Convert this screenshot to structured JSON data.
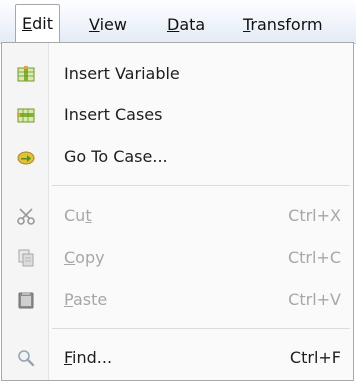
{
  "menubar": {
    "items": [
      {
        "label": "Edit",
        "mnemonic": "E",
        "rest": "dit",
        "active": true
      },
      {
        "label": "View",
        "mnemonic": "V",
        "rest": "iew"
      },
      {
        "label": "Data",
        "mnemonic": "D",
        "rest": "ata"
      },
      {
        "label": "Transform",
        "mnemonic": "T",
        "rest": "ransform"
      }
    ]
  },
  "edit_menu": {
    "items": [
      {
        "label": "Insert Variable",
        "icon": "insert-variable-icon",
        "enabled": true
      },
      {
        "label": "Insert Cases",
        "icon": "insert-cases-icon",
        "enabled": true
      },
      {
        "label": "Go To Case...",
        "icon": "go-to-case-icon",
        "enabled": true
      },
      {
        "label": "Cut",
        "pre": "Cu",
        "mnemonic": "t",
        "post": "",
        "shortcut": "Ctrl+X",
        "icon": "scissors-icon",
        "enabled": false
      },
      {
        "label": "Copy",
        "pre": "",
        "mnemonic": "C",
        "post": "opy",
        "shortcut": "Ctrl+C",
        "icon": "copy-icon",
        "enabled": false
      },
      {
        "label": "Paste",
        "pre": "",
        "mnemonic": "P",
        "post": "aste",
        "shortcut": "Ctrl+V",
        "icon": "clipboard-icon",
        "enabled": false
      },
      {
        "label": "Find...",
        "pre": "",
        "mnemonic": "F",
        "post": "ind...",
        "shortcut": "Ctrl+F",
        "icon": "magnifier-icon",
        "enabled": true
      }
    ]
  },
  "colors": {
    "enabled_text": "#1e1e1e",
    "disabled_text": "#a7a7a7",
    "menubar_bg": "#eef3fa"
  }
}
